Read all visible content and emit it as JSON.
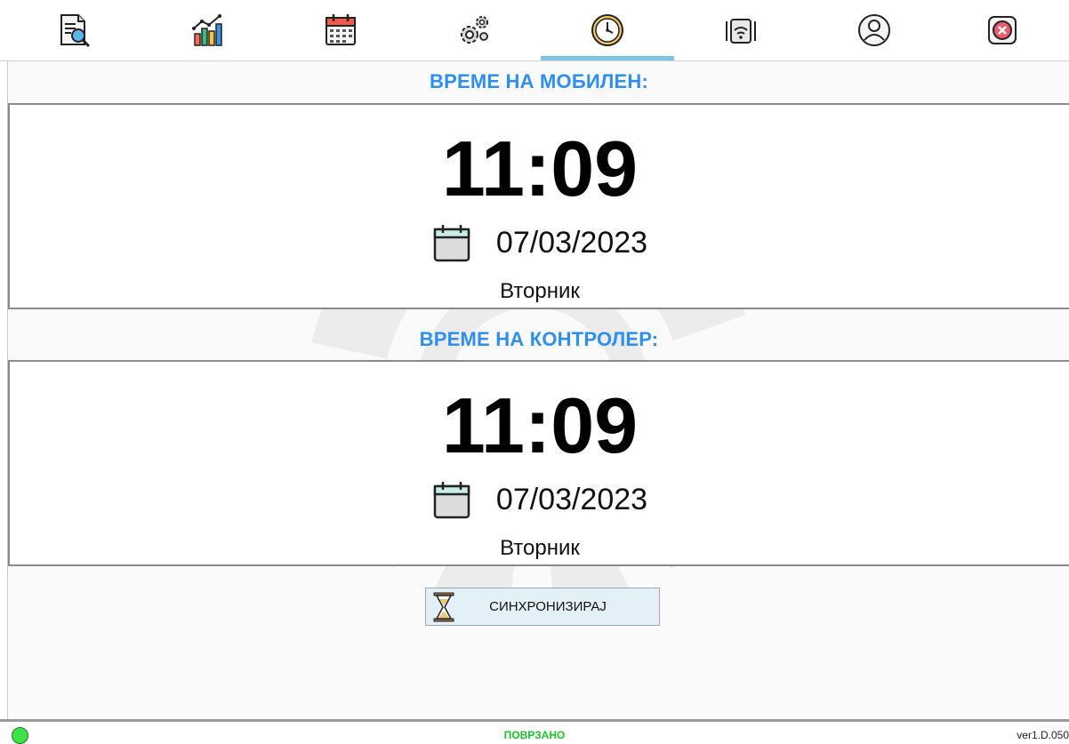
{
  "toolbar": {
    "tabs": [
      {
        "icon": "report-search-icon",
        "active": false
      },
      {
        "icon": "chart-icon",
        "active": false
      },
      {
        "icon": "calendar-icon",
        "active": false
      },
      {
        "icon": "gears-icon",
        "active": false
      },
      {
        "icon": "clock-icon",
        "active": true
      },
      {
        "icon": "wireless-device-icon",
        "active": false
      },
      {
        "icon": "user-icon",
        "active": false
      },
      {
        "icon": "close-icon",
        "active": false
      }
    ],
    "accent_color": "#7dc3e6"
  },
  "mobile": {
    "title": "ВРЕМЕ НА МОБИЛЕН:",
    "time": "11:09",
    "date": "07/03/2023",
    "day": "Вторник"
  },
  "controller": {
    "title": "ВРЕМЕ НА КОНТРОЛЕР:",
    "time": "11:09",
    "date": "07/03/2023",
    "day": "Вторник"
  },
  "sync_button": {
    "label": "СИНХРОНИЗИРАЈ",
    "icon": "hourglass-icon"
  },
  "status": {
    "text": "ПОВРЗАНО",
    "color": "#19c22a",
    "indicator": "status-dot-icon",
    "version": "ver1.D.050"
  },
  "colors": {
    "title": "#2f8ff0",
    "button_bg": "#e3f0f7"
  }
}
